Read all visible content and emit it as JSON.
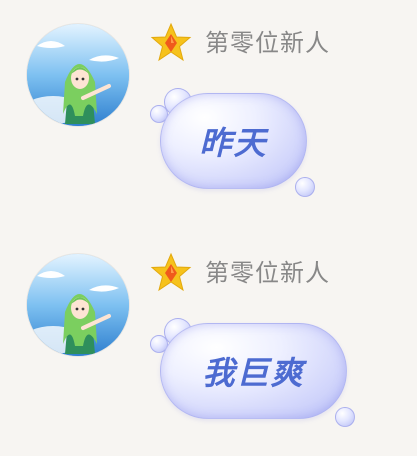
{
  "messages": [
    {
      "sender": "第零位新人",
      "badge_icon": "star-badge-icon",
      "avatar": "anime-girl-avatar",
      "text": "昨天"
    },
    {
      "sender": "第零位新人",
      "badge_icon": "star-badge-icon",
      "avatar": "anime-girl-avatar",
      "text": "我巨爽"
    }
  ],
  "colors": {
    "background": "#f7f5f2",
    "username": "#888888",
    "bubble_text": "#4d6bd1",
    "bubble_fill": "#cfd3fb",
    "badge_star": "#f6c21c",
    "badge_gem": "#f05a1c"
  }
}
